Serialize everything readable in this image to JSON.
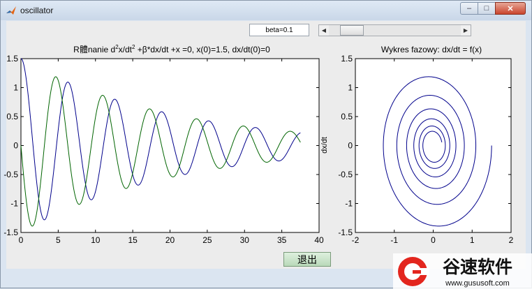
{
  "window": {
    "title": "oscillator",
    "buttons": {
      "minimize": "–",
      "maximize": "□",
      "close": "✕"
    }
  },
  "controls": {
    "beta_label": "beta=0.1",
    "slider_value": 0.1,
    "slider_min": 0,
    "slider_max": 1,
    "exit_label": "退出"
  },
  "watermark": {
    "brand": "谷速软件",
    "url": "www.gususoft.com"
  },
  "chart_data": [
    {
      "type": "line",
      "title_prefix": "R體nanie d",
      "title_sup1": "2",
      "title_mid": "x/dt",
      "title_sup2": "2",
      "title_suffix": " +β*dx/dt +x =0,   x(0)=1.5,  dx/dt(0)=0",
      "xlabel": "",
      "ylabel": "",
      "xlim": [
        0,
        40
      ],
      "ylim": [
        -1.5,
        1.5
      ],
      "xticks": [
        0,
        5,
        10,
        15,
        20,
        25,
        30,
        35,
        40
      ],
      "xtick_labels": [
        "0",
        "5",
        "10",
        "15",
        "20",
        "25",
        "30",
        "35",
        "40"
      ],
      "yticks": [
        -1.5,
        -1,
        -0.5,
        0,
        0.5,
        1,
        1.5
      ],
      "ytick_labels": [
        "-1.5",
        "-1",
        "-0.5",
        "0",
        "0.5",
        "1",
        "1.5"
      ],
      "grid": false,
      "beta": 0.1,
      "x0": 1.5,
      "v0": 0,
      "t_end": 37.5,
      "series": [
        {
          "color": "#00008b"
        },
        {
          "color": "#006400"
        }
      ]
    },
    {
      "type": "line",
      "title": "Wykres fazowy:  dx/dt = f(x)",
      "xlabel": "",
      "ylabel": "dx/dt",
      "xlim": [
        -2,
        2
      ],
      "ylim": [
        -1.5,
        1.5
      ],
      "xticks": [
        -2,
        -1,
        0,
        1,
        2
      ],
      "xtick_labels": [
        "-2",
        "-1",
        "0",
        "1",
        "2"
      ],
      "yticks": [
        -1.5,
        -1,
        -0.5,
        0,
        0.5,
        1,
        1.5
      ],
      "ytick_labels": [
        "-1.5",
        "-1",
        "-0.5",
        "0",
        "0.5",
        "1",
        "1.5"
      ],
      "grid": false,
      "series": [
        {
          "color": "#00008b"
        }
      ]
    }
  ]
}
